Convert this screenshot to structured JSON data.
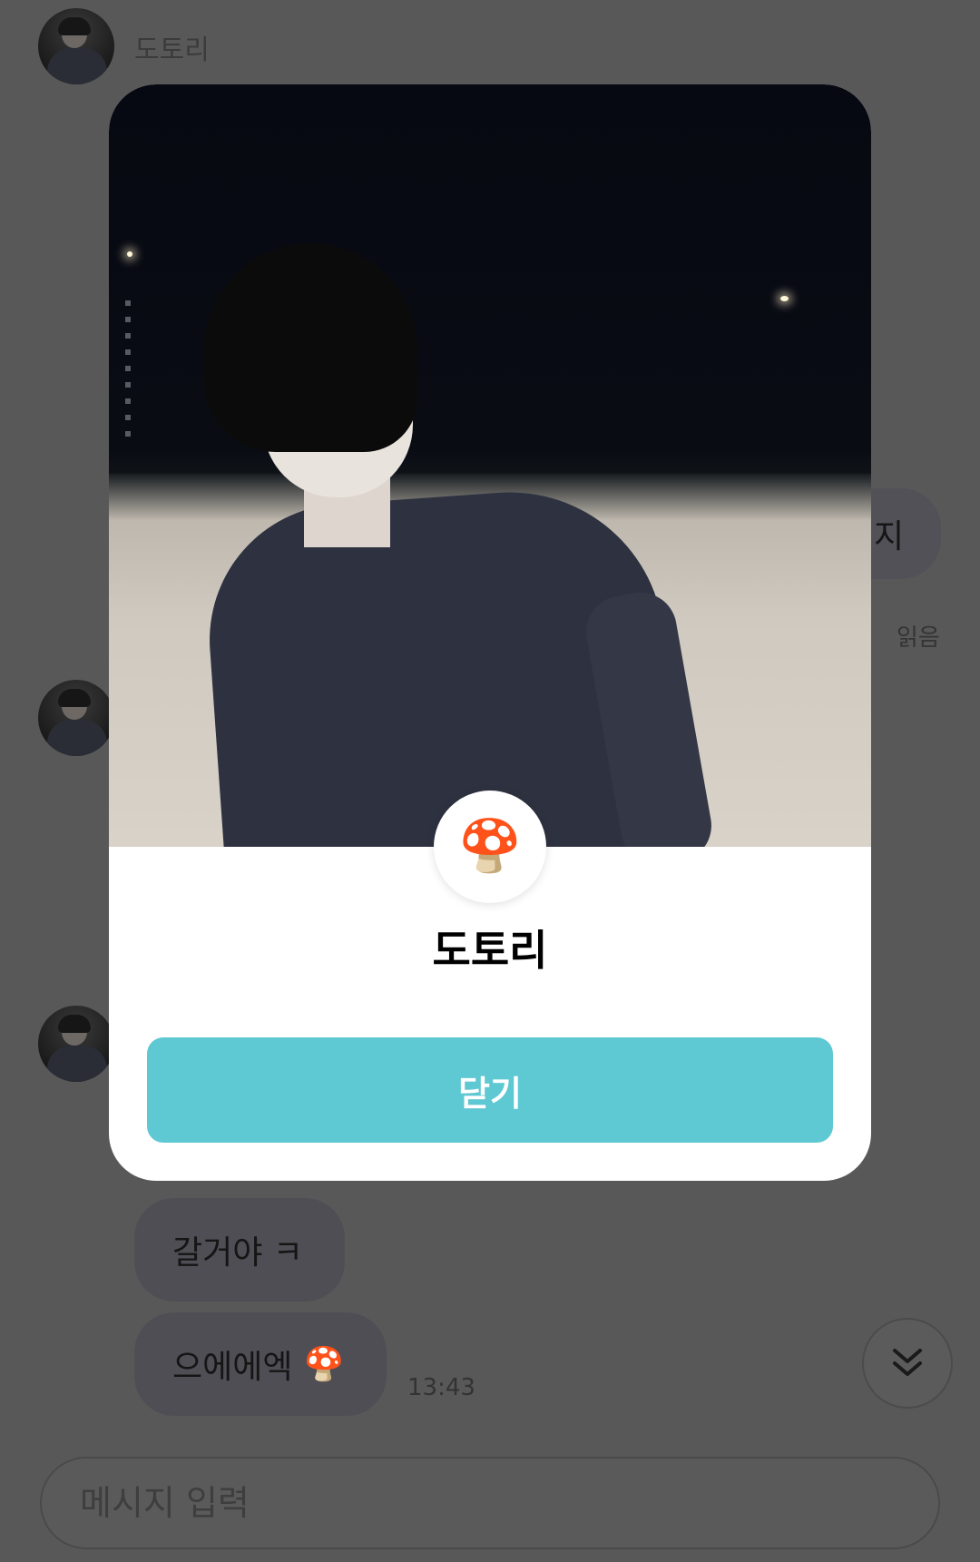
{
  "chat": {
    "sender_name": "도토리",
    "messages": [
      {
        "text": "갈거야 ㅋ",
        "emoji": ""
      },
      {
        "text": "으에에엑",
        "emoji": "🍄"
      }
    ],
    "partial_right_bubble": "지",
    "last_time": "13:43",
    "read_label": "읽음",
    "input": {
      "placeholder": "메시지 입력",
      "value": ""
    },
    "scroll_down_icon": "double-chevron-down-icon"
  },
  "profile_modal": {
    "name": "도토리",
    "badge_emoji": "🍄",
    "close_label": "닫기",
    "accent_color": "#5ec8d3"
  }
}
